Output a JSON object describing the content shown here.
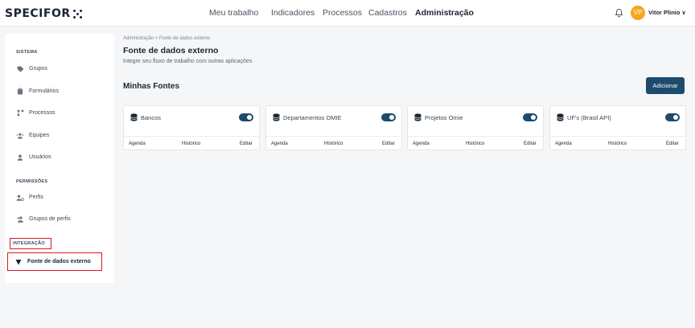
{
  "header": {
    "logo": "SPECIFOR",
    "nav": [
      "Meu trabalho",
      "Indicadores",
      "Processos",
      "Cadastros",
      "Administração"
    ],
    "active_nav": "Administração",
    "user_initials": "VP",
    "user_name": "Vitor Plinio",
    "colors": {
      "avatar": "#f5a623",
      "primary": "#1d4b6e"
    }
  },
  "sidebar": {
    "sections": [
      {
        "title": "SISTEMA",
        "items": [
          {
            "label": "Grupos",
            "icon": "tag-icon"
          },
          {
            "label": "Formulários",
            "icon": "clipboard-icon"
          },
          {
            "label": "Processos",
            "icon": "flow-icon"
          },
          {
            "label": "Equipes",
            "icon": "team-icon"
          },
          {
            "label": "Usuários",
            "icon": "user-icon"
          }
        ]
      },
      {
        "title": "PERMISSÕES",
        "items": [
          {
            "label": "Perfis",
            "icon": "profile-icon"
          },
          {
            "label": "Grupos de perfis",
            "icon": "profile-group-icon"
          }
        ]
      },
      {
        "title": "INTEGRAÇÃO",
        "items": [
          {
            "label": "Fonte de dados externo",
            "icon": "funnel-icon",
            "selected": true
          }
        ]
      }
    ]
  },
  "main": {
    "breadcrumb": "Administração  >  Fonte de dados externo",
    "title": "Fonte de dados externo",
    "subtitle": "Integre seu fluxo de trabalho com outras aplicações",
    "section_title": "Minhas Fontes",
    "add_button": "Adicionar",
    "sources": [
      {
        "name": "Bancos",
        "enabled": true
      },
      {
        "name": "Departamentos OMIE",
        "enabled": true
      },
      {
        "name": "Projetos Omie",
        "enabled": true
      },
      {
        "name": "UF's (Brasil API)",
        "enabled": true
      }
    ],
    "card_actions": {
      "schedule": "Agenda",
      "history": "Histórico",
      "edit": "Editar"
    }
  }
}
